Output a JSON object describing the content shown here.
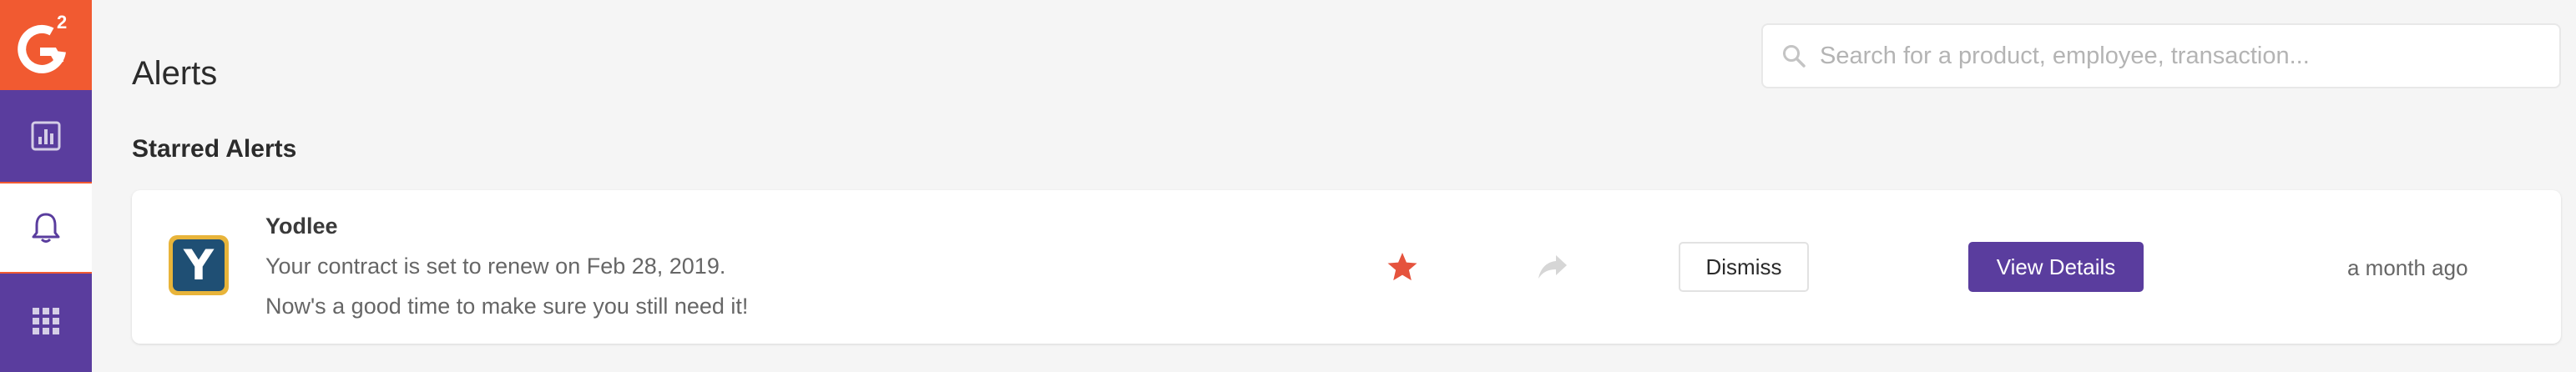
{
  "app": {
    "logo_text": "G2",
    "brand_color": "#f15a31",
    "accent_color": "#5a3d9e"
  },
  "sidebar": {
    "items": [
      {
        "icon": "bar-chart-icon",
        "active": false
      },
      {
        "icon": "bell-icon",
        "active": true
      },
      {
        "icon": "apps-grid-icon",
        "active": false
      }
    ]
  },
  "header": {
    "title": "Alerts"
  },
  "search": {
    "placeholder": "Search for a product, employee, transaction...",
    "value": ""
  },
  "section": {
    "title": "Starred Alerts"
  },
  "alerts": [
    {
      "vendor": "Yodlee",
      "logo_letter": "Y",
      "line1": "Your contract is set to renew on Feb 28, 2019.",
      "line2": "Now's a good time to make sure you still need it!",
      "starred": true,
      "dismiss_label": "Dismiss",
      "view_label": "View Details",
      "timestamp": "a month ago"
    }
  ]
}
